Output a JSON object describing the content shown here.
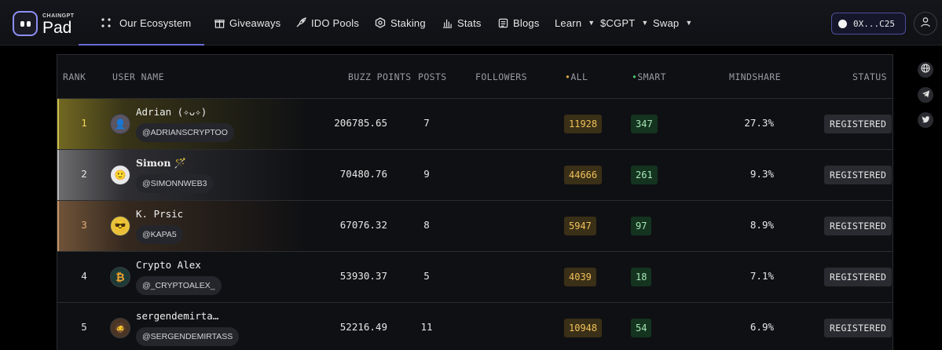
{
  "brand": {
    "sub": "CHAINGPT",
    "name": "Pad"
  },
  "nav": {
    "ecosystem": "Our Ecosystem",
    "giveaways": "Giveaways",
    "ido_pools": "IDO Pools",
    "staking": "Staking",
    "stats": "Stats",
    "blogs": "Blogs",
    "learn": "Learn",
    "cgpt": "$CGPT",
    "swap": "Swap"
  },
  "wallet": {
    "address": "0X...C25"
  },
  "icons": {
    "ecosystem": "grid-dots-icon",
    "giveaways": "gift-icon",
    "ido_pools": "rocket-icon",
    "staking": "hexagon-icon",
    "stats": "bar-chart-icon",
    "blogs": "document-icon",
    "user": "user-icon",
    "social": [
      "globe-icon",
      "telegram-icon",
      "twitter-icon"
    ]
  },
  "colors": {
    "accent": "#6a6bd8",
    "all_points": "#f0c25a",
    "smart_points": "#a8e6b6",
    "gold": "#cfc04a",
    "silver": "#b8b8b8",
    "bronze": "#c79464"
  },
  "table": {
    "headers": {
      "rank": "RANK",
      "user_name": "USER NAME",
      "buzz_points": "BUZZ POINTS",
      "posts": "POSTS",
      "followers": "FOLLOWERS",
      "all": "ALL",
      "smart": "SMART",
      "mindshare": "MINDSHARE",
      "status": "STATUS"
    },
    "rows": [
      {
        "rank": "1",
        "name": "Adrian (✧ᴗ✧)",
        "handle": "@ADRIANSCRYPTOO",
        "buzz": "206785.65",
        "posts": "7",
        "all": "11928",
        "smart": "347",
        "mindshare": "27.3%",
        "status": "REGISTERED",
        "avatar": "👤"
      },
      {
        "rank": "2",
        "name": "Simon 🪄",
        "handle": "@SIMONNWEB3",
        "buzz": "70480.76",
        "posts": "9",
        "all": "44666",
        "smart": "261",
        "mindshare": "9.3%",
        "status": "REGISTERED",
        "avatar": "🙂"
      },
      {
        "rank": "3",
        "name": "K. Prsic",
        "handle": "@KAPA5",
        "buzz": "67076.32",
        "posts": "8",
        "all": "5947",
        "smart": "97",
        "mindshare": "8.9%",
        "status": "REGISTERED",
        "avatar": "😎"
      },
      {
        "rank": "4",
        "name": "Crypto Alex",
        "handle": "@_CRYPTOALEX_",
        "buzz": "53930.37",
        "posts": "5",
        "all": "4039",
        "smart": "18",
        "mindshare": "7.1%",
        "status": "REGISTERED",
        "avatar": "₿"
      },
      {
        "rank": "5",
        "name": "sergendemirta…",
        "handle": "@SERGENDEMIRTASS",
        "buzz": "52216.49",
        "posts": "11",
        "all": "10948",
        "smart": "54",
        "mindshare": "6.9%",
        "status": "REGISTERED",
        "avatar": "🧔"
      }
    ]
  }
}
